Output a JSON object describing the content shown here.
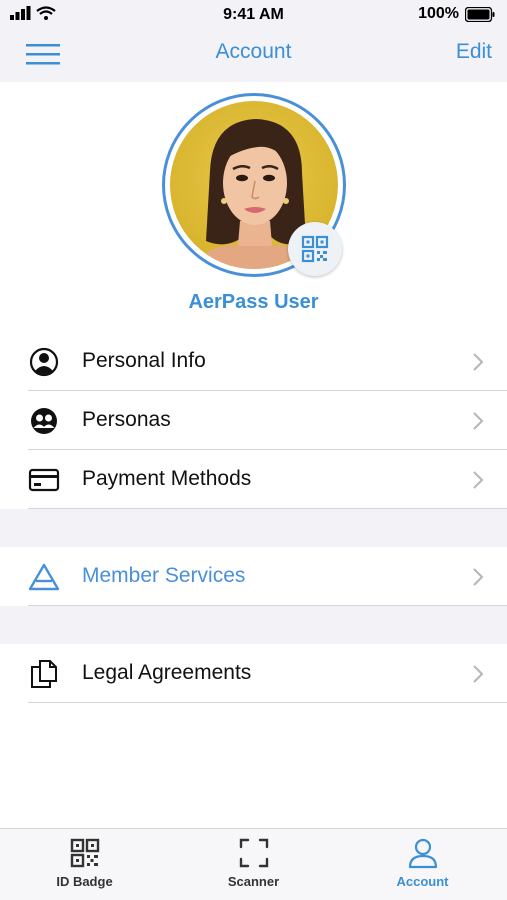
{
  "status_bar": {
    "time": "9:41 AM",
    "battery": "100%"
  },
  "nav": {
    "title": "Account",
    "edit_label": "Edit"
  },
  "profile": {
    "name": "AerPass User"
  },
  "menu": {
    "personal_info": "Personal Info",
    "personas": "Personas",
    "payment_methods": "Payment Methods",
    "member_services": "Member Services",
    "legal_agreements": "Legal Agreements"
  },
  "tabs": {
    "id_badge": "ID Badge",
    "scanner": "Scanner",
    "account": "Account"
  },
  "colors": {
    "accent": "#3b8fd6",
    "background_gray": "#f2f2f7"
  }
}
